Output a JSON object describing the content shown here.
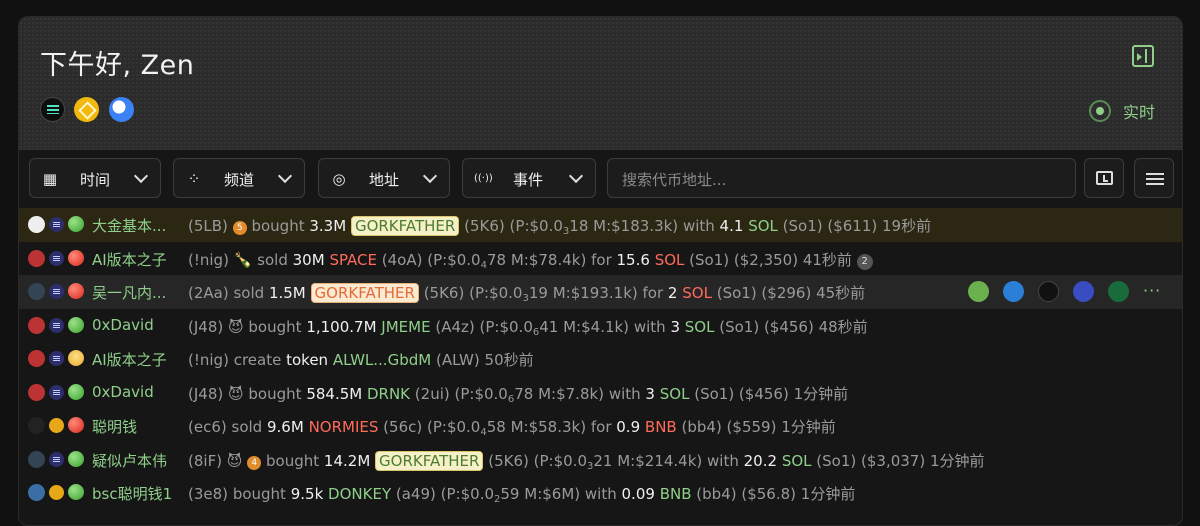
{
  "header": {
    "greeting": "下午好, Zen",
    "realtime_label": "实时"
  },
  "chains": [
    "solana-icon",
    "bnb-icon",
    "base-icon"
  ],
  "filters": [
    {
      "label": "时间",
      "icon": "calendar-icon",
      "glyph": "▦"
    },
    {
      "label": "频道",
      "icon": "grid-icon",
      "glyph": "⁘"
    },
    {
      "label": "地址",
      "icon": "target-icon",
      "glyph": "◎"
    },
    {
      "label": "事件",
      "icon": "broadcast-icon",
      "glyph": "((·))"
    }
  ],
  "search": {
    "placeholder": "搜索代币地址..."
  },
  "feed": [
    {
      "name": "大金基本...",
      "id": "(5LB)",
      "pre": "5",
      "verb": "bought",
      "amount": "3.3M",
      "token": "GORKFATHER",
      "token_style": "badge",
      "contract": "(5K6)",
      "price": "(P:$0.0",
      "sub": "3",
      "price2": "18 M:$183.3k)",
      "conj": "with",
      "qty": "4.1",
      "chain": "SOL",
      "tail": "(So1) ($611) 19秒前",
      "highlight": "gold"
    },
    {
      "name": "AI版本之子",
      "id": "(",
      "pre": "!nig) 🍾",
      "verb": "sold",
      "amount": "30M",
      "token": "SPACE",
      "token_style": "red",
      "contract": "(4oA)",
      "price": "(P:$0.0",
      "sub": "4",
      "price2": "78 M:$78.4k)",
      "conj": "for",
      "qty": "15.6",
      "chain": "SOL",
      "tail": "(So1) ($2,350) 41秒前",
      "count": "2",
      "highlight": ""
    },
    {
      "name": "吴一凡内...",
      "id": "(2Aa)",
      "pre": "",
      "verb": "sold",
      "amount": "1.5M",
      "token": "GORKFATHER",
      "token_style": "badge-o",
      "contract": "(5K6)",
      "price": "(P:$0.0",
      "sub": "3",
      "price2": "19 M:$193.1k)",
      "conj": "for",
      "qty": "2",
      "chain": "SOL",
      "tail": "(So1) ($296) 45秒前",
      "highlight": "grey"
    },
    {
      "name": "0xDavid",
      "id": "(J48) 😈",
      "pre": "",
      "verb": "bought",
      "amount": "1,100.7M",
      "token": "JMEME",
      "token_style": "green",
      "contract": "(A4z)",
      "price": "(P:$0.0",
      "sub": "6",
      "price2": "41 M:$4.1k)",
      "conj": "with",
      "qty": "3",
      "chain": "SOL",
      "tail": "(So1) ($456) 48秒前",
      "highlight": ""
    },
    {
      "name": "AI版本之子",
      "id": "(",
      "pre": "!nig)",
      "verb": "create",
      "amount": "token",
      "token": "ALWL...GbdM",
      "token_style": "green",
      "contract": "(ALW)",
      "price": "",
      "sub": "",
      "price2": "",
      "conj": "",
      "qty": "",
      "chain": "",
      "tail": "50秒前",
      "highlight": ""
    },
    {
      "name": "0xDavid",
      "id": "(J48) 😈",
      "pre": "",
      "verb": "bought",
      "amount": "584.5M",
      "token": "DRNK",
      "token_style": "green",
      "contract": "(2ui)",
      "price": "(P:$0.0",
      "sub": "6",
      "price2": "78 M:$7.8k)",
      "conj": "with",
      "qty": "3",
      "chain": "SOL",
      "tail": "(So1) ($456) 1分钟前",
      "highlight": ""
    },
    {
      "name": "聪明钱",
      "id": "(ec6)",
      "pre": "",
      "verb": "sold",
      "amount": "9.6M",
      "token": "NORMIES",
      "token_style": "red",
      "contract": "(56c)",
      "price": "(P:$0.0",
      "sub": "4",
      "price2": "58 M:$58.3k)",
      "conj": "for",
      "qty": "0.9",
      "chain": "BNB",
      "tail": "(bb4) ($559) 1分钟前",
      "highlight": ""
    },
    {
      "name": "疑似卢本伟",
      "id": "(8iF) 😈",
      "pre": "4",
      "verb": "bought",
      "amount": "14.2M",
      "token": "GORKFATHER",
      "token_style": "badge",
      "contract": "(5K6)",
      "price": "(P:$0.0",
      "sub": "3",
      "price2": "21 M:$214.4k)",
      "conj": "with",
      "qty": "20.2",
      "chain": "SOL",
      "tail": "(So1) ($3,037) 1分钟前",
      "highlight": ""
    },
    {
      "name": "bsc聪明钱1",
      "id": "(3e8)",
      "pre": "",
      "verb": "bought",
      "amount": "9.5k",
      "token": "DONKEY",
      "token_style": "green",
      "contract": "(a49)",
      "price": "(P:$0.0",
      "sub": "2",
      "price2": "59 M:$6M)",
      "conj": "with",
      "qty": "0.09",
      "chain": "BNB",
      "tail": "(bb4) ($56.8) 1分钟前",
      "highlight": ""
    }
  ],
  "row_actions": [
    "frog-icon",
    "delta-icon",
    "triangle-icon",
    "swallow-icon",
    "bull-icon",
    "more-icon"
  ],
  "more_label": "···"
}
